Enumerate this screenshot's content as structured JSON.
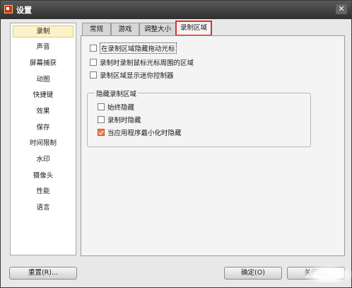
{
  "window": {
    "title": "设置"
  },
  "sidebar": {
    "items": [
      {
        "label": "录制",
        "selected": true
      },
      {
        "label": "声音"
      },
      {
        "label": "屏幕捕获"
      },
      {
        "label": "动图"
      },
      {
        "label": "快捷键"
      },
      {
        "label": "效果"
      },
      {
        "label": "保存"
      },
      {
        "label": "时间限制"
      },
      {
        "label": "水印"
      },
      {
        "label": "摄像头"
      },
      {
        "label": "性能"
      },
      {
        "label": "语言"
      }
    ]
  },
  "tabs": [
    {
      "label": "常规"
    },
    {
      "label": "游戏"
    },
    {
      "label": "调整大小"
    },
    {
      "label": "录制区域",
      "active": true
    }
  ],
  "options": [
    {
      "label": "在录制区域隐藏拖动光标",
      "checked": false,
      "focused": true
    },
    {
      "label": "录制时录制鼠标光标周围的区域",
      "checked": false
    },
    {
      "label": "录制区域显示迷你控制器",
      "checked": false
    }
  ],
  "hide_group": {
    "title": "隐藏录制区域",
    "options": [
      {
        "label": "始终隐藏",
        "checked": false
      },
      {
        "label": "录制时隐藏",
        "checked": false
      },
      {
        "label": "当应用程序最小化时隐藏",
        "checked": true
      }
    ]
  },
  "buttons": {
    "reset": "重置(R)...",
    "ok": "确定(O)",
    "close": "关闭(C)"
  },
  "colors": {
    "highlight": "#d9312b",
    "selected_bg": "#fbf2c8",
    "checked": "#f07a4b"
  }
}
